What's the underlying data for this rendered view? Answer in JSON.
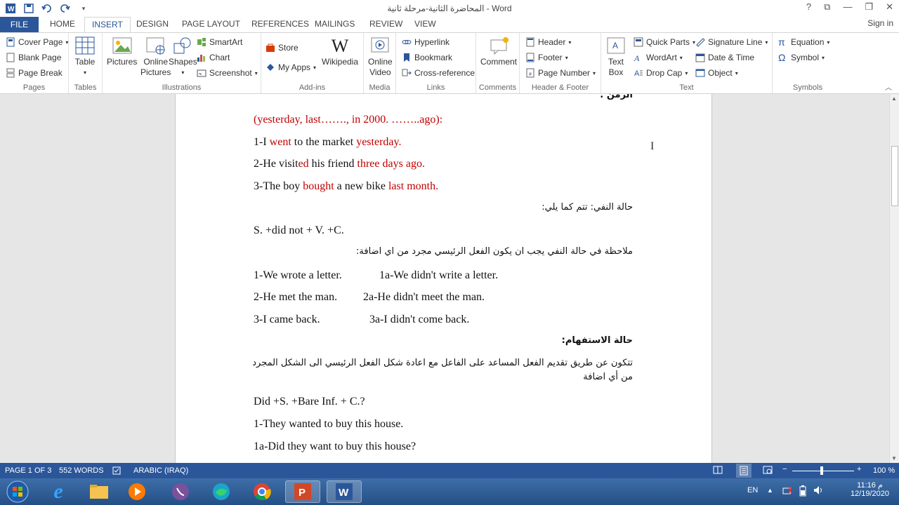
{
  "window": {
    "title": "المحاضرة الثانية-مرحلة ثانية - Word",
    "controls": {
      "help": "?",
      "restore_ribbon": "⧉",
      "minimize": "—",
      "maximize": "❐",
      "close": "✕"
    },
    "signin": "Sign in"
  },
  "tabs": [
    "FILE",
    "HOME",
    "INSERT",
    "DESIGN",
    "PAGE LAYOUT",
    "REFERENCES",
    "MAILINGS",
    "REVIEW",
    "VIEW"
  ],
  "ribbon": {
    "pages": {
      "label": "Pages",
      "items": [
        "Cover Page",
        "Blank Page",
        "Page Break"
      ]
    },
    "tables": {
      "label": "Tables",
      "table": "Table"
    },
    "illustrations": {
      "label": "Illustrations",
      "pictures": "Pictures",
      "online_pictures_1": "Online",
      "online_pictures_2": "Pictures",
      "shapes": "Shapes",
      "smartart": "SmartArt",
      "chart": "Chart",
      "screenshot": "Screenshot"
    },
    "addins": {
      "label": "Add-ins",
      "store": "Store",
      "my_apps": "My Apps",
      "wikipedia": "Wikipedia"
    },
    "media": {
      "label": "Media",
      "online_video_1": "Online",
      "online_video_2": "Video"
    },
    "links": {
      "label": "Links",
      "hyperlink": "Hyperlink",
      "bookmark": "Bookmark",
      "cross_reference": "Cross-reference"
    },
    "comments": {
      "label": "Comments",
      "comment": "Comment"
    },
    "header_footer": {
      "label": "Header & Footer",
      "header": "Header",
      "footer": "Footer",
      "page_number": "Page Number"
    },
    "text": {
      "label": "Text",
      "text_box_1": "Text",
      "text_box_2": "Box",
      "quick_parts": "Quick Parts",
      "wordart": "WordArt",
      "drop_cap": "Drop Cap",
      "signature_line": "Signature Line",
      "date_time": "Date & Time",
      "object": "Object"
    },
    "symbols": {
      "label": "Symbols",
      "equation": "Equation",
      "symbol": "Symbol"
    }
  },
  "document": {
    "l0": "الزمن :",
    "l1": "(yesterday, last……., in 2000. ……..ago):",
    "l2a": "1-I ",
    "l2b": "went",
    "l2c": " to the market ",
    "l2d": "yesterday.",
    "l3a": "2-He visit",
    "l3b": "ed",
    "l3c": " his friend ",
    "l3d": "three days ago.",
    "l4a": "3-The boy ",
    "l4b": "bought",
    "l4c": " a new bike ",
    "l4d": "last month.",
    "l5": "حالة النفي: تتم كما يلي:",
    "l6": "S. +did not + V. +C.",
    "l7": "ملاحظة في حالة النفي يجب ان يكون الفعل الرئيسي مجرد من اي اضافة:",
    "l8a": "1-We wrote a letter.",
    "l8b": "1a-We didn't write a letter.",
    "l9a": "2-He met the man.",
    "l9b": "2a-He didn't meet the man.",
    "l10a": "3-I came back.",
    "l10b": "3a-I didn't come back.",
    "l11": "حالة الاستفهام:",
    "l12": "تتكون عن طريق تقديم الفعل المساعد على الفاعل مع اعادة شكل الفعل الرئيسي الى الشكل المجرد",
    "l13": "من أي اضافة",
    "l14": "Did +S. +Bare Inf. + C.?",
    "l15": "1-They wanted to buy this house.",
    "l16": "1a-Did they want to buy this house?"
  },
  "statusbar": {
    "page": "PAGE 1 OF 3",
    "words": "552 WORDS",
    "language": "ARABIC (IRAQ)",
    "zoom": "100 %"
  },
  "taskbar": {
    "lang": "EN",
    "time": "11:16 م",
    "date": "12/19/2020"
  },
  "colors": {
    "accent": "#2b579a",
    "red_text": "#c00000"
  }
}
